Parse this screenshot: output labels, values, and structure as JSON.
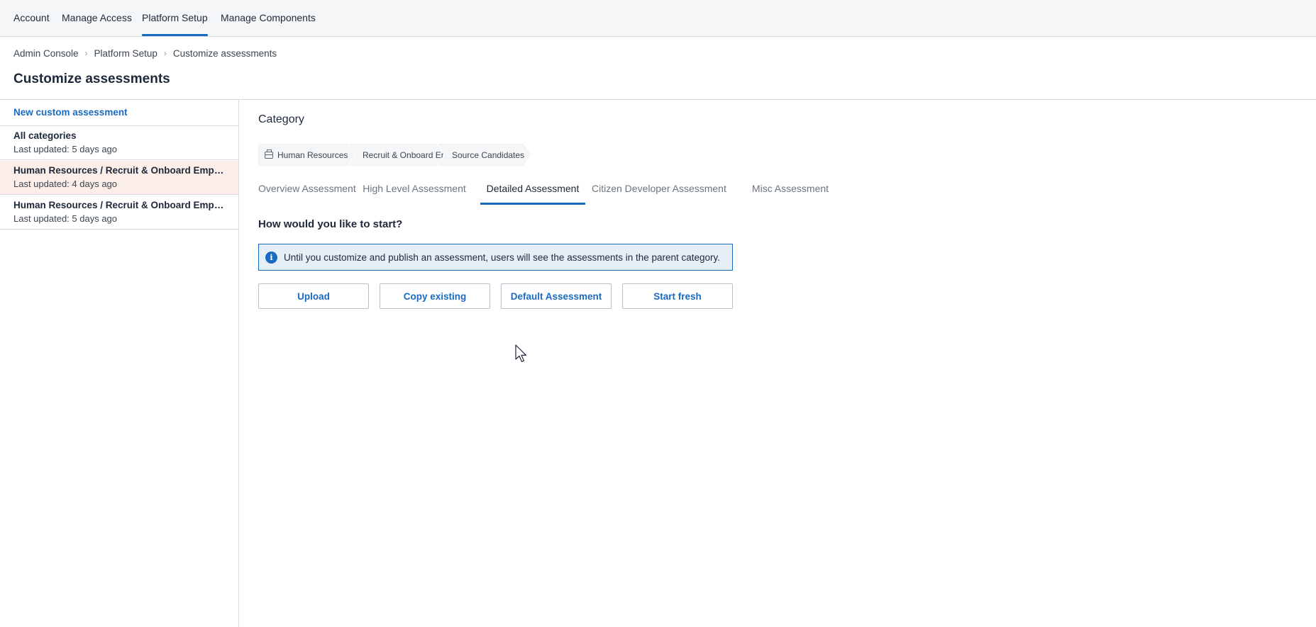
{
  "topnav": {
    "items": [
      {
        "label": "Account",
        "active": false
      },
      {
        "label": "Manage Access",
        "active": false
      },
      {
        "label": "Platform Setup",
        "active": true
      },
      {
        "label": "Manage Components",
        "active": false
      }
    ]
  },
  "breadcrumb": {
    "items": [
      "Admin Console",
      "Platform Setup",
      "Customize assessments"
    ],
    "separator": "›"
  },
  "page": {
    "title": "Customize assessments"
  },
  "sidebar": {
    "new_label": "New custom assessment",
    "items": [
      {
        "title": "All categories",
        "subtitle": "Last updated: 5 days ago",
        "selected": false
      },
      {
        "title": "Human Resources / Recruit & Onboard Employees / Source Candidates",
        "subtitle": "Last updated: 4 days ago",
        "selected": true
      },
      {
        "title": "Human Resources / Recruit & Onboard Employees",
        "subtitle": "Last updated: 5 days ago",
        "selected": false
      }
    ]
  },
  "main": {
    "category_label": "Category",
    "category_path": [
      {
        "label": "Human Resources",
        "icon": "briefcase-icon"
      },
      {
        "label": "Recruit & Onboard Employees"
      },
      {
        "label": "Source Candidates"
      }
    ],
    "tabs": [
      {
        "label": "Overview Assessment",
        "active": false
      },
      {
        "label": "High Level Assessment",
        "active": false
      },
      {
        "label": "Detailed Assessment",
        "active": true
      },
      {
        "label": "Citizen Developer Assessment",
        "active": false
      },
      {
        "label": "Misc Assessment",
        "active": false
      }
    ],
    "start_question": "How would you like to start?",
    "info": {
      "icon": "info-icon",
      "glyph": "i",
      "text": "Until you customize and publish an assessment, users will see the assessments in the parent category."
    },
    "options": [
      "Upload",
      "Copy existing",
      "Default Assessment",
      "Start fresh"
    ]
  },
  "colors": {
    "accent": "#1a6bbf",
    "nav_bg": "#f4f6f8",
    "selected_row_bg": "#fbeee8",
    "info_bg": "#e6eff7",
    "border": "#d5dbe1"
  }
}
